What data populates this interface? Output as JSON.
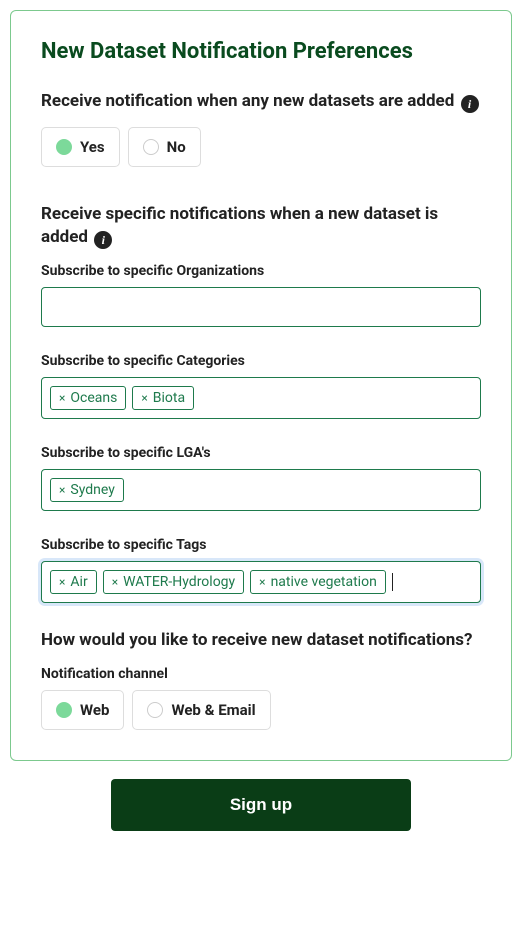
{
  "title": "New Dataset Notification Preferences",
  "anyNew": {
    "heading": "Receive notification when any new datasets are added",
    "options": {
      "yes": "Yes",
      "no": "No"
    }
  },
  "specific": {
    "heading": "Receive specific notifications when a new dataset is added",
    "orgs": {
      "label": "Subscribe to specific Organizations",
      "tags": []
    },
    "categories": {
      "label": "Subscribe to specific Categories",
      "tags": [
        "Oceans",
        "Biota"
      ]
    },
    "lgas": {
      "label": "Subscribe to specific LGA's",
      "tags": [
        "Sydney"
      ]
    },
    "tagsField": {
      "label": "Subscribe to specific Tags",
      "tags": [
        "Air",
        "WATER-Hydrology",
        "native vegetation"
      ]
    }
  },
  "channel": {
    "heading": "How would you like to receive new dataset notifications?",
    "label": "Notification channel",
    "options": {
      "web": "Web",
      "webEmail": "Web & Email"
    }
  },
  "signup": "Sign up"
}
